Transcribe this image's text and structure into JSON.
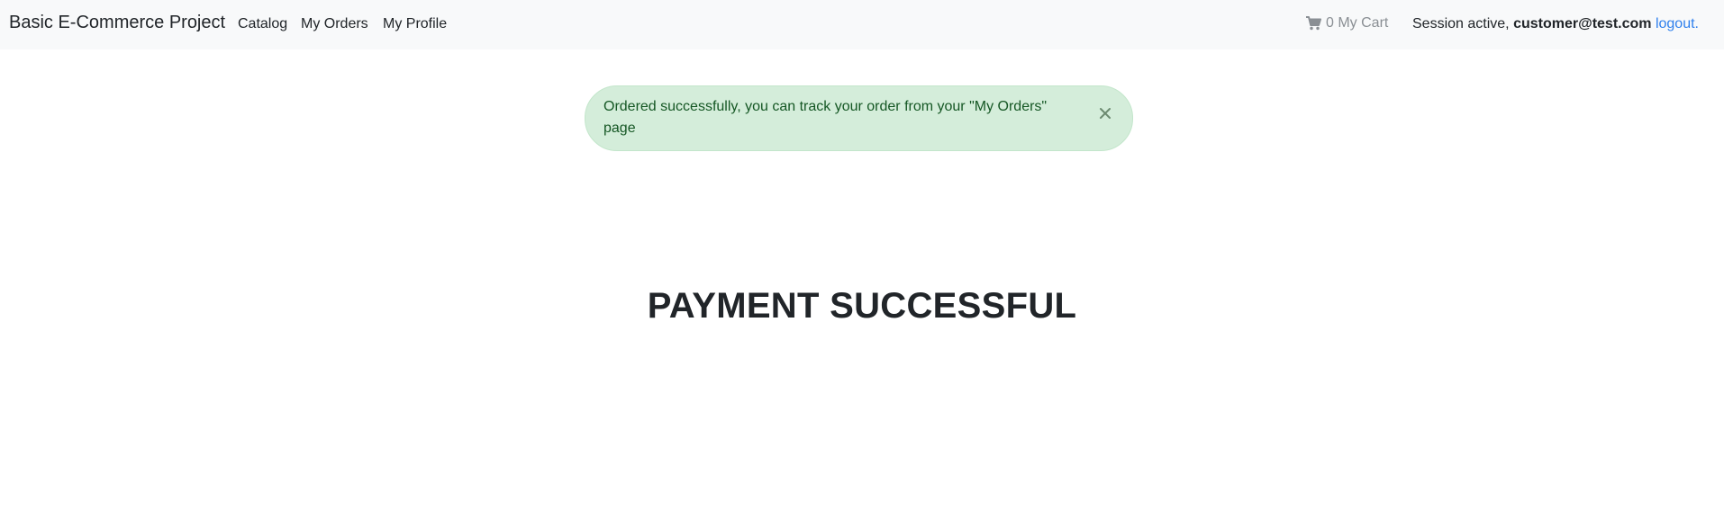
{
  "navbar": {
    "brand": "Basic E-Commerce Project",
    "links": [
      "Catalog",
      "My Orders",
      "My Profile"
    ],
    "cart": {
      "count_label": "0 My Cart",
      "icon": "cart-icon"
    },
    "session": {
      "prefix": "Session active,",
      "email": "customer@test.com",
      "logout": "logout."
    }
  },
  "alert": {
    "message": "Ordered successfully, you can track your order from your \"My Orders\" page",
    "close_icon": "close-icon",
    "color": "#d4edda"
  },
  "main": {
    "heading": "PAYMENT SUCCESSFUL"
  }
}
